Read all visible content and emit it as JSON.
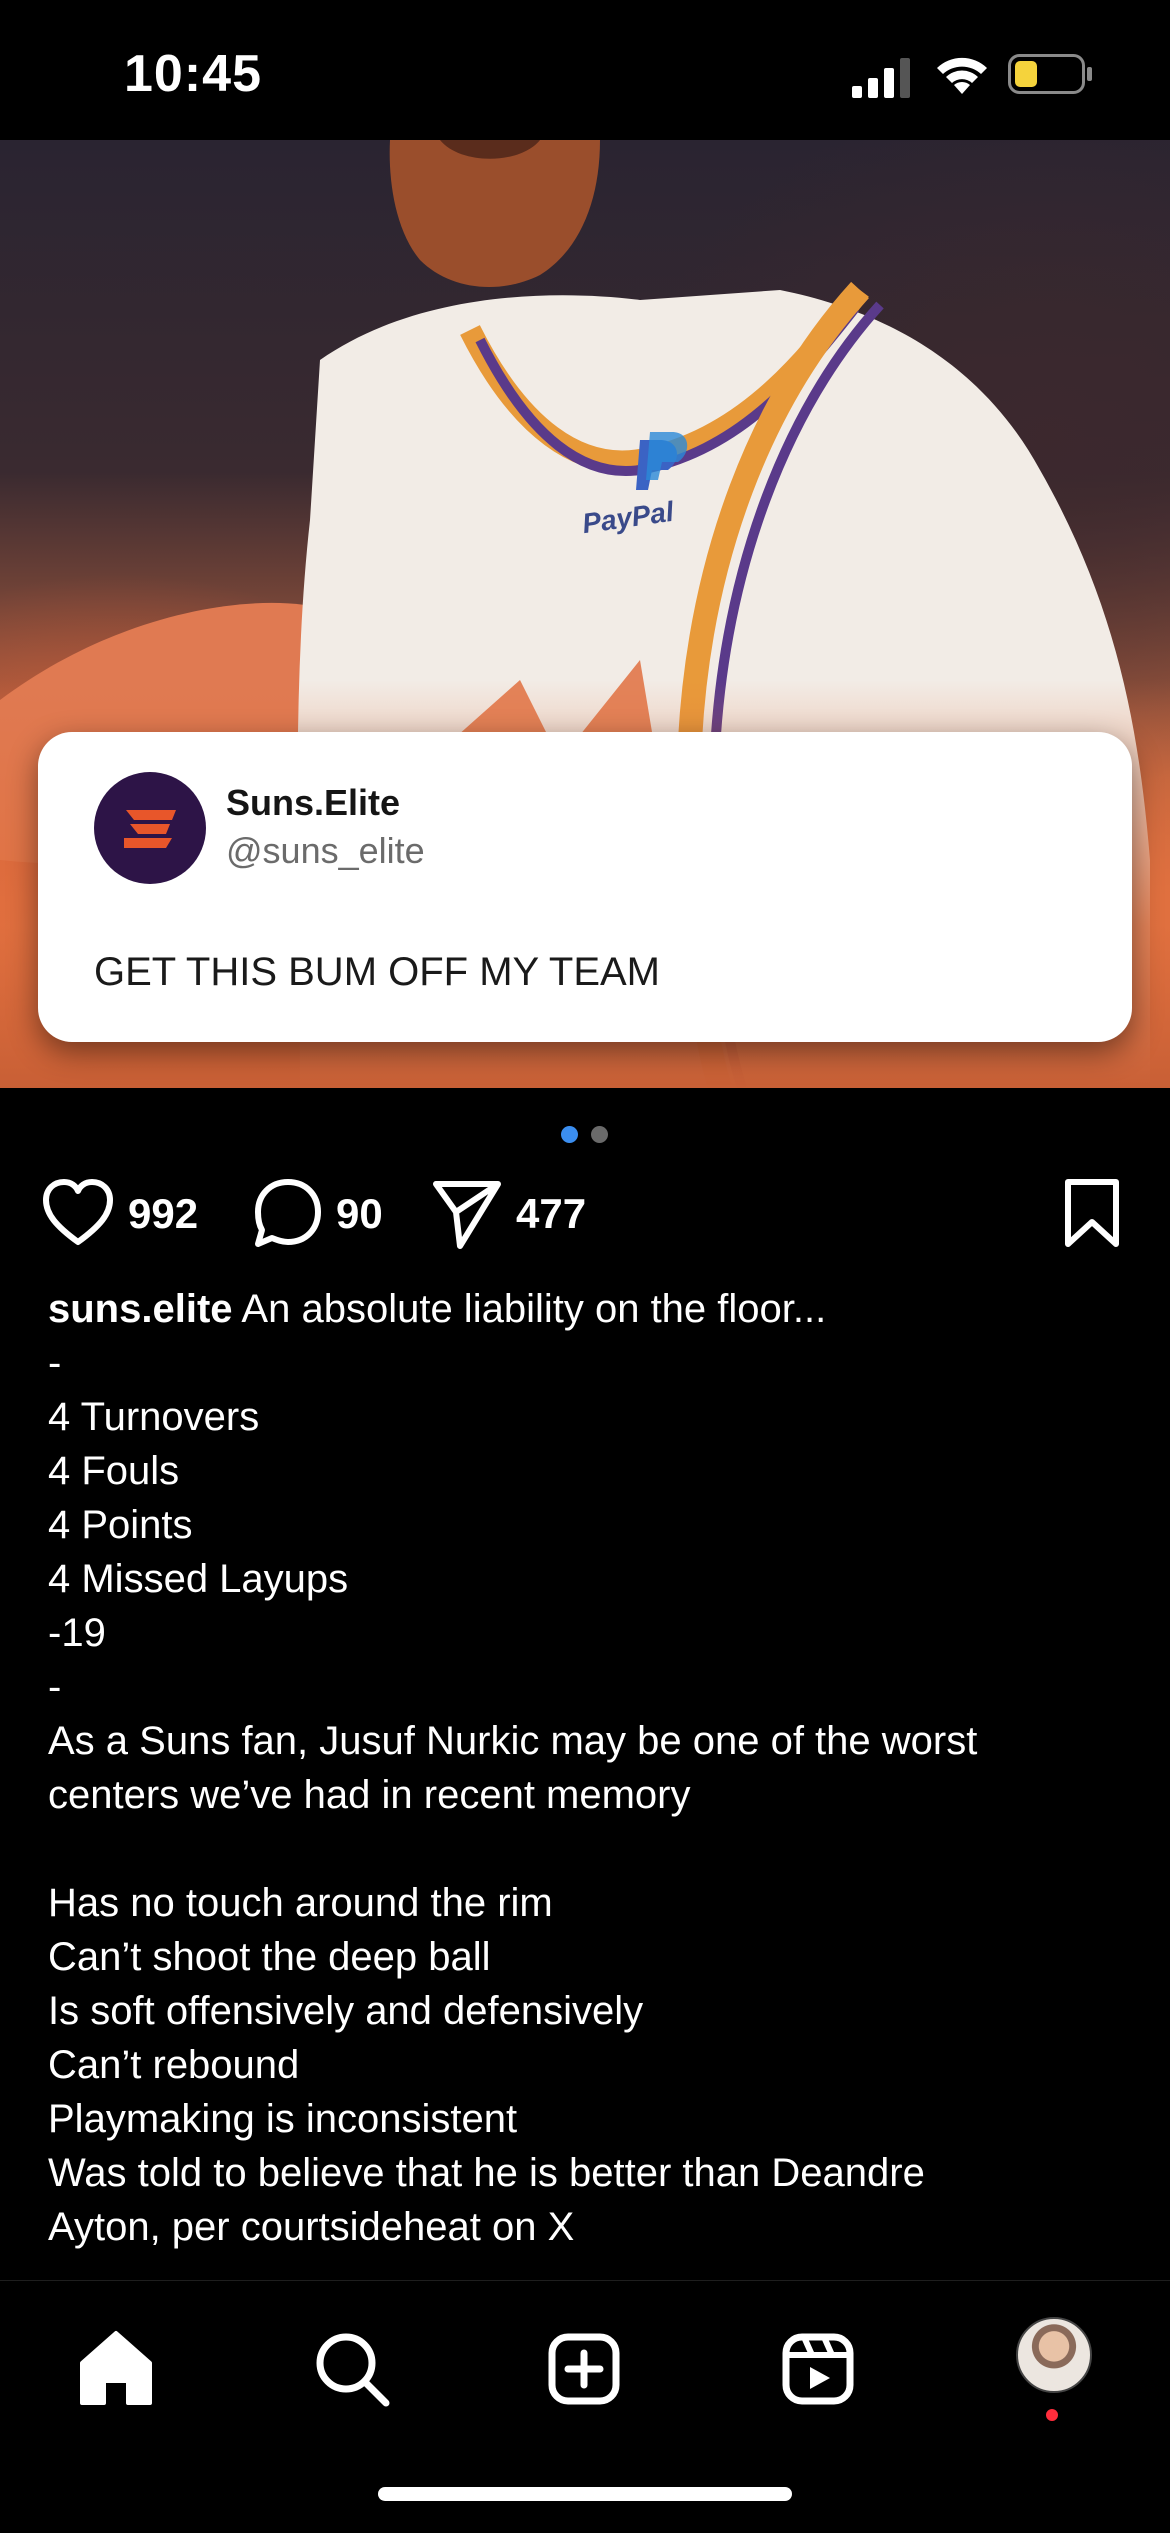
{
  "status_bar": {
    "time": "10:45",
    "icons": [
      "cellular-signal-icon",
      "wifi-icon",
      "battery-icon"
    ],
    "battery_color": "#f5d33c"
  },
  "post": {
    "image": {
      "jersey_sponsor": "PayPal",
      "tweet": {
        "avatar_icon": "suns-elite-logo-icon",
        "name": "Suns.Elite",
        "handle": "@suns_elite",
        "text": "GET THIS BUM OFF MY TEAM"
      }
    },
    "carousel": {
      "current": 1,
      "total": 2
    },
    "actions": {
      "likes": "992",
      "comments": "90",
      "shares": "477"
    },
    "caption": {
      "username": "suns.elite",
      "first_line": " An absolute liability on the floor...",
      "lines": [
        "-",
        "4 Turnovers",
        "4 Fouls",
        "4 Points",
        "4 Missed Layups",
        "-19",
        "-",
        "As a Suns fan, Jusuf Nurkic may be one of the worst",
        "centers we’ve had in recent memory",
        "",
        "Has no touch around the rim",
        "Can’t shoot the deep ball",
        "Is soft offensively and defensively",
        "Can’t rebound",
        "Playmaking is inconsistent",
        "Was told to believe that he is better than Deandre",
        "Ayton, per courtsideheat on X",
        "——————————"
      ]
    }
  },
  "bottom_nav": {
    "items": [
      "home-icon",
      "search-icon",
      "create-post-icon",
      "reels-icon",
      "profile-avatar"
    ],
    "active": "home-icon",
    "notification_color": "#ff2d3c"
  },
  "colors": {
    "accent_dot": "#3b8ef0",
    "suns_purple": "#2d1447",
    "suns_orange": "#e8562a"
  }
}
